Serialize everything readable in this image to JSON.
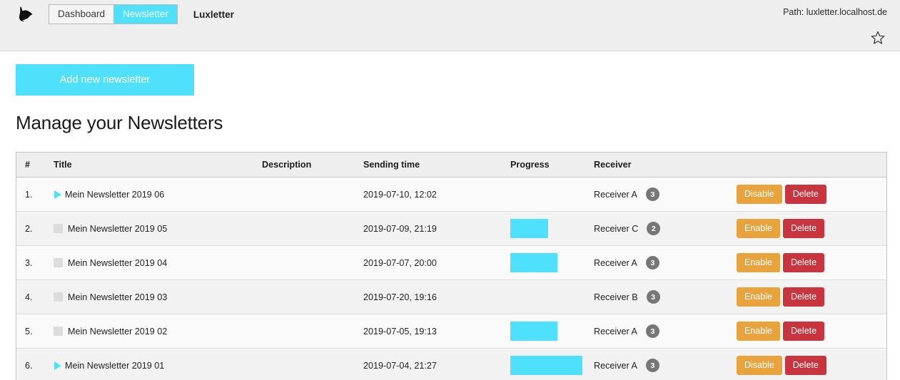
{
  "header": {
    "logo_icon": "dog-head-logo-icon",
    "modules": [
      {
        "label": "Dashboard",
        "active": false
      },
      {
        "label": "Newsletter",
        "active": true
      }
    ],
    "module_title": "Luxletter",
    "path_label": "Path: luxletter.localhost.de",
    "bookmark_icon": "star-outline-icon"
  },
  "toolbar": {
    "add_label": "Add new newsletter"
  },
  "main": {
    "page_title": "Manage your Newsletters",
    "columns": [
      "#",
      "Title",
      "Description",
      "Sending time",
      "Progress",
      "Receiver",
      ""
    ],
    "rows": [
      {
        "num": "1.",
        "state": "active",
        "state_icon": "play-triangle-icon",
        "title": "Mein Newsletter 2019 06",
        "description": "",
        "sending_time": "2019-07-10, 12:02",
        "progress": 0,
        "receiver": "Receiver A",
        "receiver_count": "3",
        "toggle_label": "Disable",
        "delete_label": "Delete"
      },
      {
        "num": "2.",
        "state": "inactive",
        "state_icon": "stop-square-icon",
        "title": "Mein Newsletter 2019 05",
        "description": "",
        "sending_time": "2019-07-09, 21:19",
        "progress": 52,
        "receiver": "Receiver C",
        "receiver_count": "2",
        "toggle_label": "Enable",
        "delete_label": "Delete"
      },
      {
        "num": "3.",
        "state": "inactive",
        "state_icon": "stop-square-icon",
        "title": "Mein Newsletter 2019 04",
        "description": "",
        "sending_time": "2019-07-07, 20:00",
        "progress": 65,
        "receiver": "Receiver A",
        "receiver_count": "3",
        "toggle_label": "Enable",
        "delete_label": "Delete"
      },
      {
        "num": "4.",
        "state": "inactive",
        "state_icon": "stop-square-icon",
        "title": "Mein Newsletter 2019 03",
        "description": "",
        "sending_time": "2019-07-20, 19:16",
        "progress": 0,
        "receiver": "Receiver B",
        "receiver_count": "3",
        "toggle_label": "Enable",
        "delete_label": "Delete"
      },
      {
        "num": "5.",
        "state": "inactive",
        "state_icon": "stop-square-icon",
        "title": "Mein Newsletter 2019 02",
        "description": "",
        "sending_time": "2019-07-05, 19:13",
        "progress": 65,
        "receiver": "Receiver A",
        "receiver_count": "3",
        "toggle_label": "Enable",
        "delete_label": "Delete"
      },
      {
        "num": "6.",
        "state": "active",
        "state_icon": "play-triangle-icon",
        "title": "Mein Newsletter 2019 01",
        "description": "",
        "sending_time": "2019-07-04, 21:27",
        "progress": 100,
        "receiver": "Receiver A",
        "receiver_count": "3",
        "toggle_label": "Disable",
        "delete_label": "Delete"
      }
    ]
  },
  "colors": {
    "accent": "#4fe0fb",
    "warning": "#e8a33d",
    "danger": "#c9353f",
    "badge": "#777777",
    "chrome": "#eeeeee"
  }
}
